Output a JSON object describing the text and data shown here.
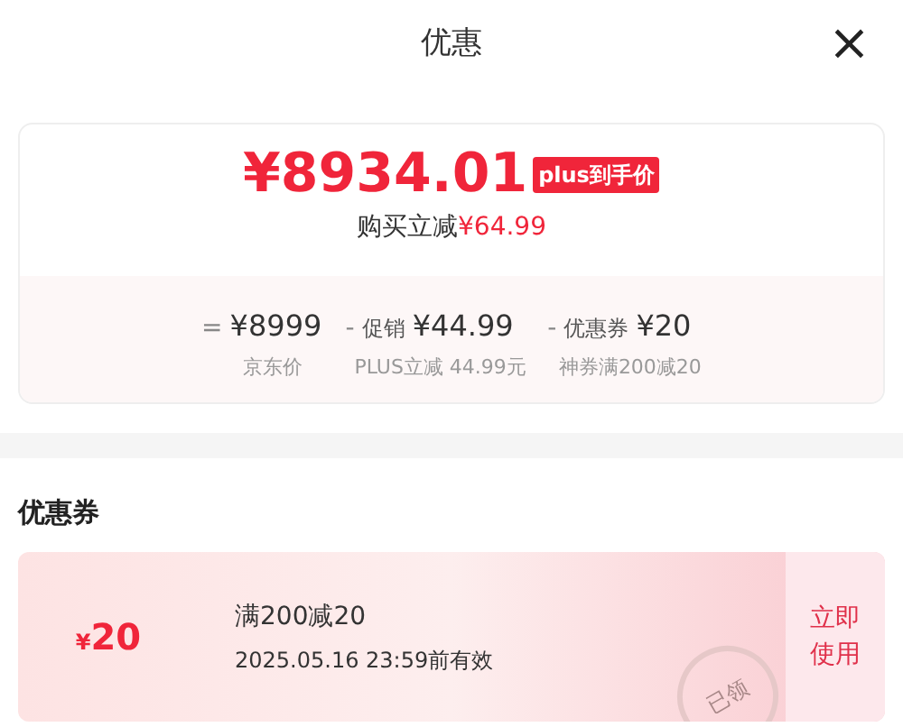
{
  "title": "优惠",
  "close": "×",
  "price": {
    "amount": "¥8934.01",
    "badge": "plus到手价",
    "saving_label": "购买立减",
    "saving": "¥64.99"
  },
  "breakdown": [
    {
      "operator": "=",
      "value": "¥8999",
      "note": "京东价"
    },
    {
      "operator": "-",
      "label": "促销",
      "value": "¥44.99",
      "note": "PLUS立减 44.99元"
    },
    {
      "operator": "-",
      "label": "优惠券",
      "value": "¥20",
      "note": "神券满200减20"
    }
  ],
  "coupons_title": "优惠券",
  "coupons": [
    {
      "currency": "¥",
      "amount": "20",
      "name": "满200减20",
      "valid": "2025.05.16 23:59前有效",
      "stamp": "已领",
      "action": "立即使用"
    }
  ]
}
